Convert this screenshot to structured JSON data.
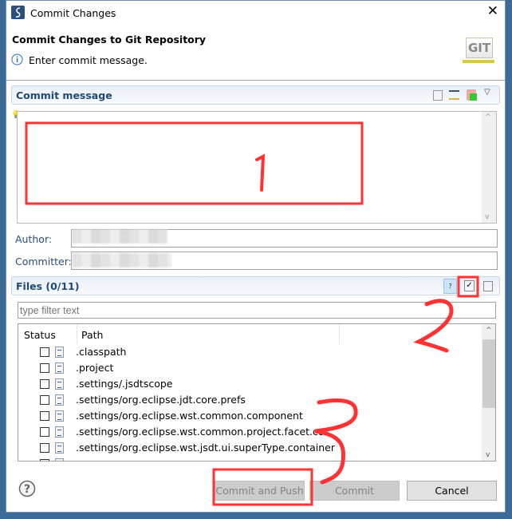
{
  "window": {
    "title": "Commit Changes",
    "close_icon": "close-icon"
  },
  "header": {
    "title": "Commit Changes to Git Repository",
    "message": "Enter commit message.",
    "logo_text": "GIT"
  },
  "commit_message": {
    "section_title": "Commit message",
    "value": ""
  },
  "author": {
    "label": "Author:",
    "value": ""
  },
  "committer": {
    "label": "Committer:",
    "value": ""
  },
  "files": {
    "section_title": "Files (0/11)",
    "filter_placeholder": "type filter text",
    "columns": [
      "Status",
      "Path"
    ],
    "rows": [
      {
        "path": ".classpath",
        "checked": false
      },
      {
        "path": ".project",
        "checked": false
      },
      {
        "path": ".settings/.jsdtscope",
        "checked": false
      },
      {
        "path": ".settings/org.eclipse.jdt.core.prefs",
        "checked": false
      },
      {
        "path": ".settings/org.eclipse.wst.common.component",
        "checked": false
      },
      {
        "path": ".settings/org.eclipse.wst.common.project.facet.cor",
        "checked": false
      },
      {
        "path": ".settings/org.eclipse.wst.jsdt.ui.superType.container",
        "checked": false
      },
      {
        "path": "",
        "checked": false
      }
    ]
  },
  "buttons": {
    "commit_and_push": "Commit and Push",
    "commit": "Commit",
    "cancel": "Cancel"
  },
  "annotations": {
    "one": "1",
    "two": "2",
    "three": "3",
    "color": "#ff3333"
  }
}
